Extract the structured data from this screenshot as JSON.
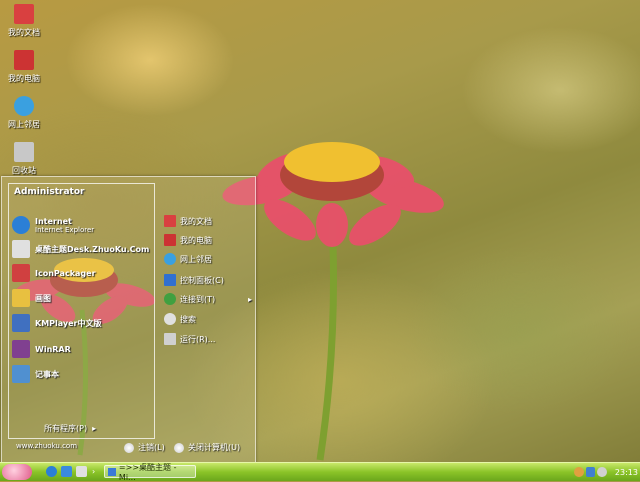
{
  "desktop": {
    "icons": [
      {
        "label": "我的文档",
        "color": "#d94040"
      },
      {
        "label": "我的电脑",
        "color": "#cc3333"
      },
      {
        "label": "网上邻居",
        "color": "#3aa0e0"
      },
      {
        "label": "回收站",
        "color": "#c8c8c8"
      }
    ]
  },
  "start_menu": {
    "user": "Administrator",
    "programs": [
      {
        "label": "Internet",
        "sub": "Internet Explorer",
        "color": "#2b7fd6",
        "icon": "ie-icon"
      },
      {
        "label": "桌酷主题Desk.ZhuoKu.Com",
        "sub": "",
        "color": "#e0e0e0",
        "icon": "zhuoku-icon"
      },
      {
        "label": "IconPackager",
        "sub": "",
        "color": "#d04040",
        "icon": "iconpackager-icon"
      },
      {
        "label": "画图",
        "sub": "",
        "color": "#e8c040",
        "icon": "paint-icon"
      },
      {
        "label": "KMPlayer中文版",
        "sub": "",
        "color": "#4070c0",
        "icon": "kmplayer-icon"
      },
      {
        "label": "WinRAR",
        "sub": "",
        "color": "#804090",
        "icon": "winrar-icon"
      },
      {
        "label": "记事本",
        "sub": "",
        "color": "#5090d0",
        "icon": "notepad-icon"
      }
    ],
    "all_programs": "所有程序(P)",
    "right_items": [
      {
        "label": "我的文档",
        "color": "#d94040"
      },
      {
        "label": "我的电脑",
        "color": "#cc3333"
      },
      {
        "label": "网上邻居",
        "color": "#3aa0e0"
      },
      {
        "label": "控制面板(C)",
        "color": "#3070d0"
      },
      {
        "label": "连接到(T)",
        "color": "#40a040"
      },
      {
        "label": "搜索",
        "color": "#e0e0e0"
      },
      {
        "label": "运行(R)...",
        "color": "#d0d0d0"
      }
    ],
    "site": "www.zhuoku.com",
    "logoff": "注销(L)",
    "shutdown": "关闭计算机(U)"
  },
  "taskbar": {
    "task_label": "=>>桌酷主题 - Mi...",
    "clock": "23:13"
  }
}
